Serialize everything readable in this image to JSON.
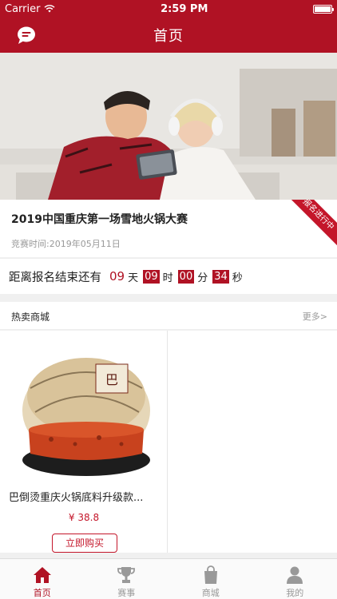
{
  "status": {
    "carrier": "Carrier",
    "time": "2:59 PM"
  },
  "nav": {
    "title": "首页"
  },
  "event": {
    "title": "2019中国重庆第一场雪地火锅大赛",
    "date_label": "竞赛时间:",
    "date": "2019年05月11日",
    "status_ribbon": "报名进行中"
  },
  "countdown": {
    "label": "距离报名结束还有",
    "days": "09",
    "days_unit": "天",
    "hours": "09",
    "hours_unit": "时",
    "minutes": "00",
    "minutes_unit": "分",
    "seconds": "34",
    "seconds_unit": "秒"
  },
  "mall": {
    "title": "热卖商城",
    "more": "更多>"
  },
  "products": [
    {
      "name": "巴倒烫重庆火锅底料升级款...",
      "price": "¥ 38.8",
      "buy_label": "立即购买"
    }
  ],
  "tabs": [
    {
      "label": "首页",
      "icon": "home-icon",
      "active": true
    },
    {
      "label": "赛事",
      "icon": "trophy-icon",
      "active": false
    },
    {
      "label": "商城",
      "icon": "shopping-bag-icon",
      "active": false
    },
    {
      "label": "我的",
      "icon": "user-icon",
      "active": false
    }
  ],
  "colors": {
    "primary": "#b01224",
    "accent": "#c4162a"
  }
}
